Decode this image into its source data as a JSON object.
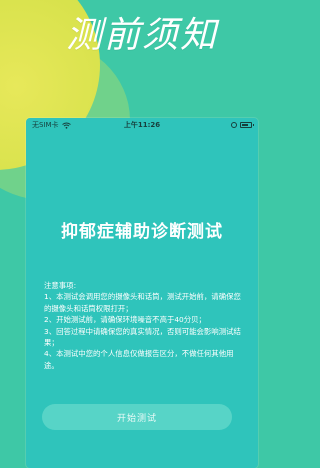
{
  "page": {
    "headline": "测前须知"
  },
  "statusbar": {
    "carrier": "无SIM卡",
    "time": "上午11:26",
    "battery_level": 0.75
  },
  "app": {
    "title": "抑郁症辅助诊断测试",
    "notice_heading": "注意事项:",
    "notice_lines": [
      "1、本测试会调用您的摄像头和话筒，测试开始前，请确保您的摄像头和话筒权限打开；",
      "2、开始测试前，请确保环境噪音不高于40分贝；",
      "3、回答过程中请确保您的真实情况，否则可能会影响测试结果；",
      "4、本测试中您的个人信息仅做报告区分，不做任何其他用途。"
    ],
    "start_label": "开始测试"
  },
  "colors": {
    "background": "#3ec8a6",
    "phone_screen": "#2fc4bb",
    "blob": "#dfe553"
  }
}
